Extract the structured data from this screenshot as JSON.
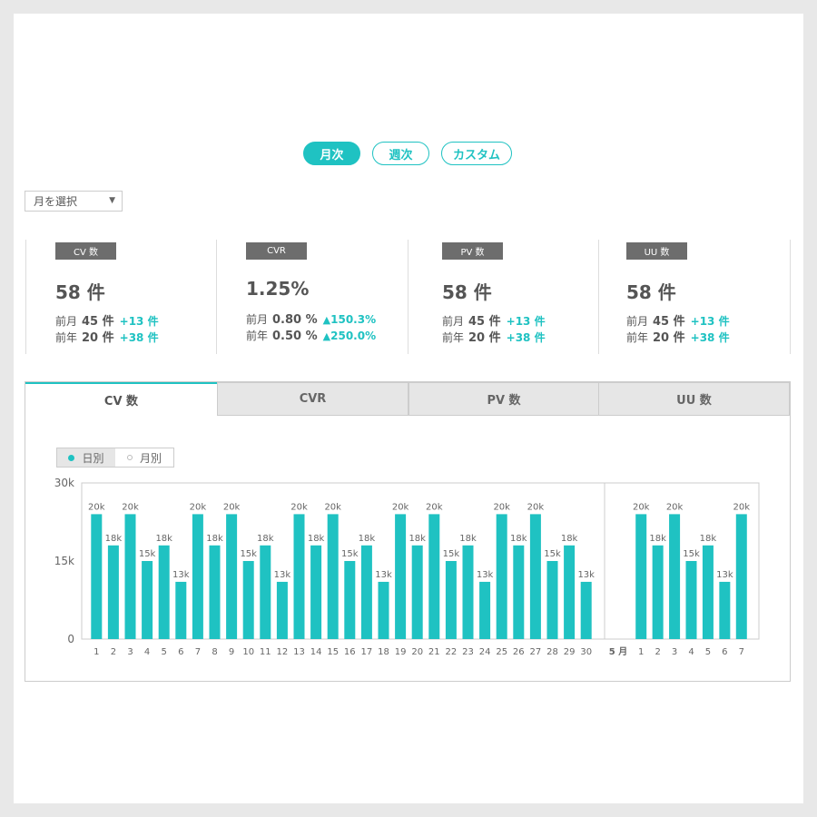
{
  "period_tabs": [
    {
      "label": "月次",
      "active": true
    },
    {
      "label": "週次",
      "active": false
    },
    {
      "label": "カスタム",
      "active": false
    }
  ],
  "month_select": {
    "placeholder": "月を選択"
  },
  "kpis": [
    {
      "tag": "CV 数",
      "value": "58 件",
      "rows": [
        {
          "label": "前月",
          "value": "45 件",
          "diff": "+13 件",
          "arrow": false
        },
        {
          "label": "前年",
          "value": "20 件",
          "diff": "+38 件",
          "arrow": false
        }
      ]
    },
    {
      "tag": "CVR",
      "value": "1.25%",
      "rows": [
        {
          "label": "前月",
          "value": "0.80 %",
          "diff": "150.3%",
          "arrow": true
        },
        {
          "label": "前年",
          "value": "0.50 %",
          "diff": "250.0%",
          "arrow": true
        }
      ]
    },
    {
      "tag": "PV 数",
      "value": "58 件",
      "rows": [
        {
          "label": "前月",
          "value": "45 件",
          "diff": "+13 件",
          "arrow": false
        },
        {
          "label": "前年",
          "value": "20 件",
          "diff": "+38 件",
          "arrow": false
        }
      ]
    },
    {
      "tag": "UU 数",
      "value": "58 件",
      "rows": [
        {
          "label": "前月",
          "value": "45 件",
          "diff": "+13 件",
          "arrow": false
        },
        {
          "label": "前年",
          "value": "20 件",
          "diff": "+38 件",
          "arrow": false
        }
      ]
    }
  ],
  "chart_tabs": [
    {
      "label": "CV 数",
      "active": true
    },
    {
      "label": "CVR",
      "active": false
    },
    {
      "label": "PV 数",
      "active": false
    },
    {
      "label": "UU 数",
      "active": false
    }
  ],
  "granularity": {
    "daily": "日別",
    "monthly": "月別",
    "selected": "daily"
  },
  "colors": {
    "accent": "#1fc2c2",
    "tag_bg": "#6d6d6d"
  },
  "chart_data": {
    "type": "bar",
    "ylim": [
      0,
      30000
    ],
    "ytick_labels": [
      "0",
      "15k",
      "30k"
    ],
    "ytick_values": [
      0,
      15000,
      30000
    ],
    "month_separator_label": "5 月",
    "segments": [
      {
        "categories": [
          "1",
          "2",
          "3",
          "4",
          "5",
          "6",
          "7",
          "8",
          "9",
          "10",
          "11",
          "12",
          "13",
          "14",
          "15",
          "16",
          "17",
          "18",
          "19",
          "20",
          "21",
          "22",
          "23",
          "24",
          "25",
          "26",
          "27",
          "28",
          "29",
          "30"
        ],
        "values": [
          24000,
          18000,
          24000,
          15000,
          18000,
          11000,
          24000,
          18000,
          24000,
          15000,
          18000,
          11000,
          24000,
          18000,
          24000,
          15000,
          18000,
          11000,
          24000,
          18000,
          24000,
          15000,
          18000,
          11000,
          24000,
          18000,
          24000,
          15000,
          18000,
          11000
        ],
        "labels": [
          "20k",
          "18k",
          "20k",
          "15k",
          "18k",
          "13k",
          "20k",
          "18k",
          "20k",
          "15k",
          "18k",
          "13k",
          "20k",
          "18k",
          "20k",
          "15k",
          "18k",
          "13k",
          "20k",
          "18k",
          "20k",
          "15k",
          "18k",
          "13k",
          "20k",
          "18k",
          "20k",
          "15k",
          "18k",
          "13k"
        ]
      },
      {
        "categories": [
          "1",
          "2",
          "3",
          "4",
          "5",
          "6",
          "7"
        ],
        "values": [
          24000,
          18000,
          24000,
          15000,
          18000,
          11000,
          24000
        ],
        "labels": [
          "20k",
          "18k",
          "20k",
          "15k",
          "18k",
          "13k",
          "20k"
        ]
      }
    ]
  }
}
